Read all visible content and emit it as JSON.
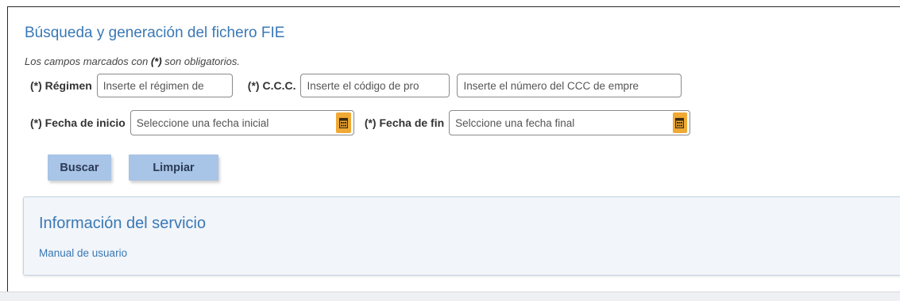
{
  "header": {
    "title": "Búsqueda y generación del fichero FIE",
    "required_prefix": "Los campos marcados con ",
    "required_mark": "(*)",
    "required_suffix": " son obligatorios."
  },
  "form": {
    "regimen": {
      "label": "(*) Régimen",
      "placeholder": "Inserte el régimen de"
    },
    "ccc": {
      "label": "(*) C.C.C.",
      "placeholder_code": "Inserte el código de pro",
      "placeholder_number": "Inserte el número del CCC de empre"
    },
    "fecha_inicio": {
      "label": "(*) Fecha de inicio",
      "placeholder": "Seleccione una fecha inicial"
    },
    "fecha_fin": {
      "label": "(*) Fecha de fin",
      "placeholder": "Selccione una fecha final"
    }
  },
  "buttons": {
    "buscar": "Buscar",
    "limpiar": "Limpiar"
  },
  "info_panel": {
    "title": "Información del servicio",
    "link": "Manual de usuario"
  },
  "colors": {
    "accent_blue": "#3a78b5",
    "button_bg": "#a8c4e6",
    "calendar_orange": "#f0a934"
  },
  "icons": {
    "calendar": "calendar-icon"
  }
}
